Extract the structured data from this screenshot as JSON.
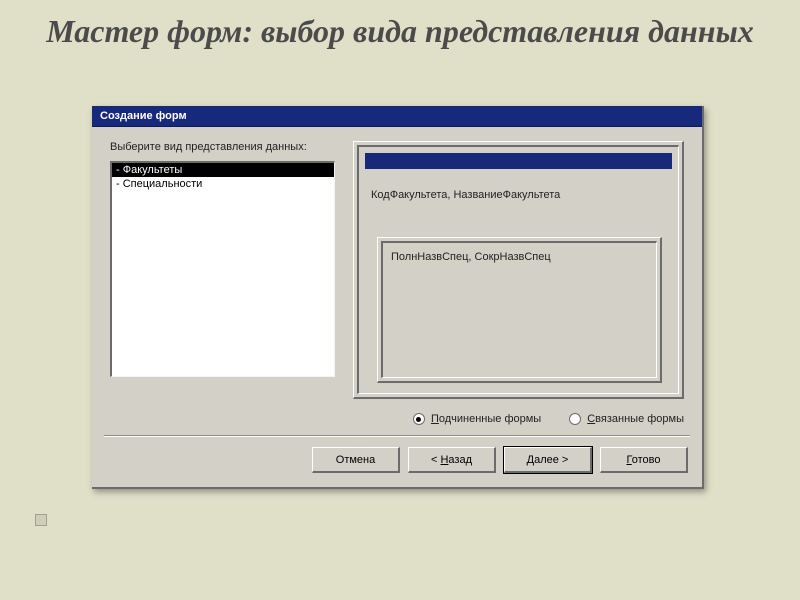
{
  "slide": {
    "title": "Мастер форм: выбор вида представления данных"
  },
  "dialog": {
    "title": "Создание форм",
    "prompt": "Выберите вид представления данных:",
    "list": {
      "items": [
        {
          "label": "- Факультеты",
          "selected": true
        },
        {
          "label": "- Специальности",
          "selected": false
        }
      ]
    },
    "preview": {
      "main_fields": "КодФакультета, НазваниеФакультета",
      "sub_fields": "ПолнНазвСпец, СокрНазвСпец"
    },
    "radios": {
      "sub": {
        "u": "П",
        "rest": "одчиненные формы",
        "checked": true
      },
      "lnk": {
        "u": "С",
        "rest": "вязанные формы",
        "checked": false
      }
    },
    "buttons": {
      "cancel": "Отмена",
      "back_lt": "< ",
      "back_u": "Н",
      "back_rest": "азад",
      "next_u": "Д",
      "next_rest": "алее >",
      "finish_u": "Г",
      "finish_rest": "отово"
    }
  }
}
